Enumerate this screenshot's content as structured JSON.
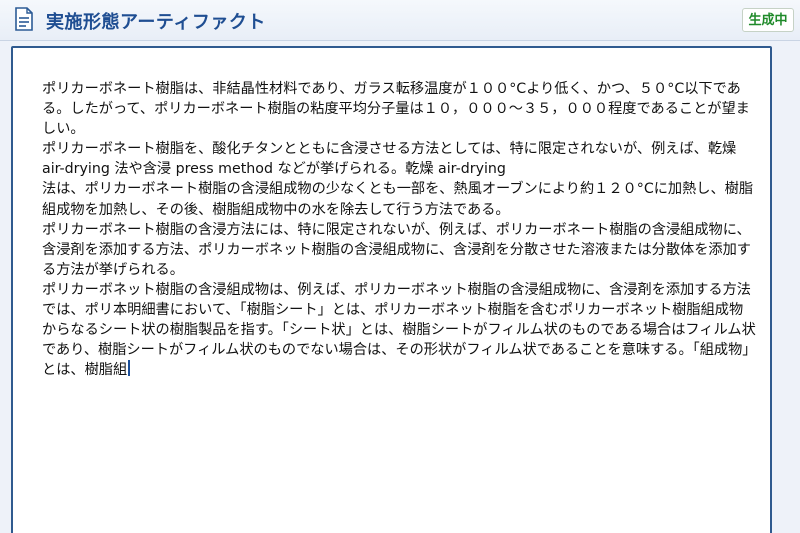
{
  "header": {
    "icon": "document-icon",
    "title": "実施形態アーティファクト",
    "status": "生成中",
    "status_color": "#1f8a2a",
    "title_color": "#1f4e92"
  },
  "editor": {
    "paragraphs": [
      "ポリカーボネート樹脂は、非結晶性材料であり、ガラス転移温度が１００°Cより低く、かつ、５０°C以下である。したがって、ポリカーボネート樹脂の粘度平均分子量は１０，０００～３５，０００程度であることが望ましい。",
      "ポリカーボネート樹脂を、酸化チタンとともに含浸させる方法としては、特に限定されないが、例えば、乾燥 air-drying 法や含浸 press method などが挙げられる。乾燥 air-drying",
      "法は、ポリカーボネート樹脂の含浸組成物の少なくとも一部を、熱風オーブンにより約１２０°Cに加熱し、樹脂組成物を加熱し、その後、樹脂組成物中の水を除去して行う方法である。",
      "ポリカーボネート樹脂の含浸方法には、特に限定されないが、例えば、ポリカーボネート樹脂の含浸組成物に、含浸剤を添加する方法、ポリカーボネット樹脂の含浸組成物に、含浸剤を分散させた溶液または分散体を添加する方法が挙げられる。",
      "ポリカーボネット樹脂の含浸組成物は、例えば、ポリカーボネット樹脂の含浸組成物に、含浸剤を添加する方法では、ポリ本明細書において、「樹脂シート」とは、ポリカーボネット樹脂を含むポリカーボネット樹脂組成物からなるシート状の樹脂製品を指す。「シート状」とは、樹脂シートがフィルム状のものである場合はフィルム状であり、樹脂シートがフィルム状のものでない場合は、その形状がフィルム状であることを意味する。「組成物」とは、樹脂組"
    ]
  }
}
